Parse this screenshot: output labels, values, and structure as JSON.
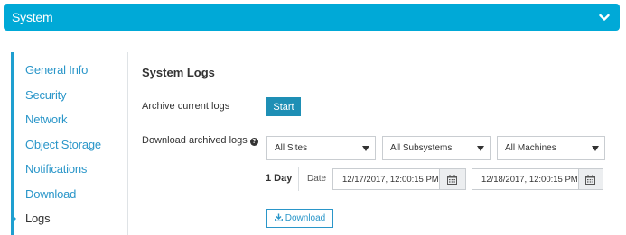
{
  "header": {
    "title": "System",
    "chevron_icon": "chevron-down-icon"
  },
  "sidebar": {
    "items": [
      {
        "label": "General Info"
      },
      {
        "label": "Security"
      },
      {
        "label": "Network"
      },
      {
        "label": "Object Storage"
      },
      {
        "label": "Notifications"
      },
      {
        "label": "Download"
      },
      {
        "label": "Logs",
        "active": true
      }
    ]
  },
  "main": {
    "title": "System Logs",
    "archive_label": "Archive current logs",
    "start_label": "Start",
    "download_label": "Download archived logs",
    "help_icon": "question-circle-icon",
    "sites_select": "All Sites",
    "subsystems_select": "All Subsystems",
    "machines_select": "All Machines",
    "range_label": "1 Day",
    "date_label": "Date",
    "start_date": "12/17/2017, 12:00:15 PM",
    "end_date": "12/18/2017, 12:00:15 PM",
    "calendar_icon": "calendar-icon",
    "download_button_label": "Download",
    "download_icon": "download-icon"
  },
  "colors": {
    "accent": "#00a9d7",
    "link": "#2a96c9",
    "button": "#1e8fb5"
  }
}
